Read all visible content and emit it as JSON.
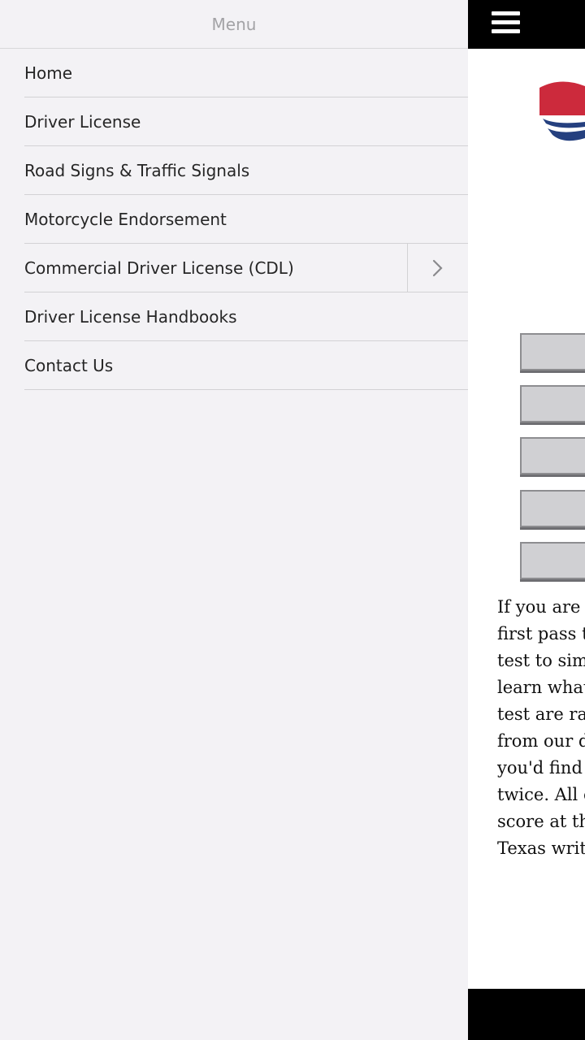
{
  "drawer": {
    "title": "Menu",
    "items": [
      {
        "label": "Home",
        "has_submenu": false
      },
      {
        "label": "Driver License",
        "has_submenu": false
      },
      {
        "label": "Road Signs & Traffic Signals",
        "has_submenu": false
      },
      {
        "label": "Motorcycle Endorsement",
        "has_submenu": false
      },
      {
        "label": "Commercial Driver License (CDL)",
        "has_submenu": true
      },
      {
        "label": "Driver License Handbooks",
        "has_submenu": false
      },
      {
        "label": "Contact Us",
        "has_submenu": false
      }
    ]
  },
  "main": {
    "menu_icon": "hamburger-menu-icon",
    "logo_icon": "shield-logo-icon",
    "colors": {
      "logo_red": "#cc2a3c",
      "logo_blue": "#25407f",
      "topbar": "#000000"
    },
    "intro_lines": [
      "If you are l",
      "first pass th",
      "test to simu",
      "learn what",
      "test are ran",
      "from our d",
      "you'd find",
      "twice. All o",
      "score at the",
      "Texas writ"
    ]
  }
}
